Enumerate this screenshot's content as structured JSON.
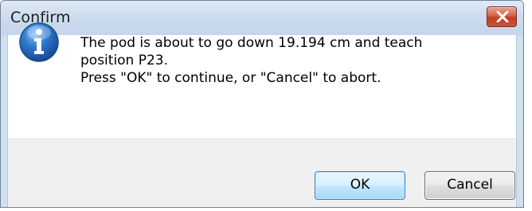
{
  "window": {
    "title": "Confirm"
  },
  "icons": {
    "close": "close-icon",
    "message_icon": "info-icon"
  },
  "message": {
    "line1": "The pod is about to go down 19.194 cm and teach",
    "line2": "position P23.",
    "line3": "Press \"OK\" to continue, or \"Cancel\" to abort."
  },
  "buttons": {
    "ok_label": "OK",
    "cancel_label": "Cancel"
  },
  "colors": {
    "titlebar": "#cddcee",
    "close_button": "#c94b33",
    "ok_border": "#3c7fb1",
    "info_icon": "#2a6fc0"
  }
}
